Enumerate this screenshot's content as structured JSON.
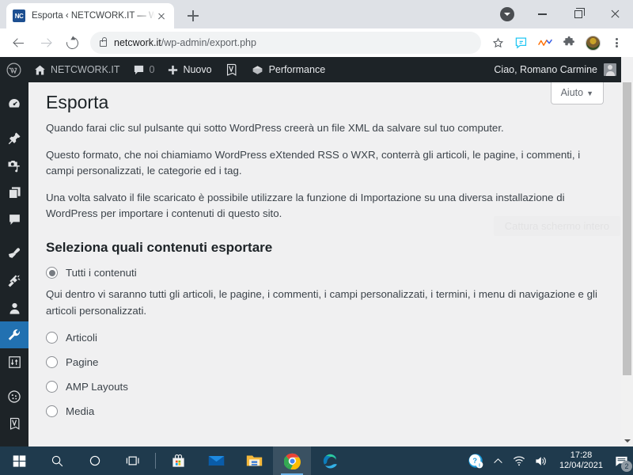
{
  "browser": {
    "tab": {
      "favicon_text": "NC",
      "title": "Esporta ‹ NETCWORK.IT — WordP",
      "close_icon": "close-icon"
    },
    "new_tab_label": "+",
    "tab_search_icon": "chevron-down-circle-icon",
    "window_controls": {
      "minimize": "minimize-icon",
      "maximize": "maximize-icon",
      "close": "close-icon"
    },
    "nav": {
      "back": "back-arrow-icon",
      "forward": "forward-arrow-icon",
      "reload": "reload-icon"
    },
    "omnibox": {
      "lock_icon": "lock-icon",
      "domain": "netcwork.it",
      "path": "/wp-admin/export.php",
      "full_url": "netcwork.it/wp-admin/export.php"
    },
    "toolbar_icons": [
      "bookmark-star-icon",
      "evernote-clipper-icon",
      "analytics-icon",
      "extensions-puzzle-icon",
      "profile-avatar",
      "chrome-menu-kebab-icon"
    ]
  },
  "adminbar": {
    "wp_logo": "wordpress-logo-icon",
    "site_icon": "home-icon",
    "site_name": "NETCWORK.IT",
    "comments_icon": "comment-bubble-icon",
    "comments_count": "0",
    "new_icon": "plus-icon",
    "new_label": "Nuovo",
    "yoast_icon": "yoast-seo-icon",
    "performance_icon": "performance-icon",
    "performance_label": "Performance",
    "greeting": "Ciao, Romano Carmine",
    "avatar": "user-avatar"
  },
  "sidebar": {
    "items": [
      {
        "name": "dashboard",
        "icon": "dashboard-gauge-icon",
        "active": false
      },
      {
        "name": "posts",
        "icon": "pin-icon",
        "active": false
      },
      {
        "name": "media",
        "icon": "media-camera-music-icon",
        "active": false
      },
      {
        "name": "pages",
        "icon": "pages-icon",
        "active": false
      },
      {
        "name": "comments",
        "icon": "comment-bubble-icon",
        "active": false
      },
      {
        "name": "appearance",
        "icon": "paintbrush-icon",
        "active": false
      },
      {
        "name": "plugins",
        "icon": "plug-icon",
        "active": false
      },
      {
        "name": "users",
        "icon": "user-icon",
        "active": false
      },
      {
        "name": "tools",
        "icon": "wrench-icon",
        "active": true
      },
      {
        "name": "settings",
        "icon": "settings-sliders-icon",
        "active": false
      },
      {
        "name": "cookies",
        "icon": "cookie-icon",
        "active": false
      },
      {
        "name": "yoast-seo",
        "icon": "yoast-seo-icon",
        "active": false
      }
    ]
  },
  "page": {
    "help_button": "Aiuto",
    "help_caret": "▼",
    "title": "Esporta",
    "paragraphs": [
      "Quando farai clic sul pulsante qui sotto WordPress creerà un file XML da salvare sul tuo computer.",
      "Questo formato, che noi chiamiamo WordPress eXtended RSS o WXR, conterrà gli articoli, le pagine, i commenti, i campi personalizzati, le categorie ed i tag.",
      "Una volta salvato il file scaricato è possibile utilizzare la funzione di Importazione su una diversa installazione di WordPress per importare i contenuti di questo sito."
    ],
    "section_title": "Seleziona quali contenuti esportare",
    "options": [
      {
        "label": "Tutti i contenuti",
        "checked": true,
        "description": "Qui dentro vi saranno tutti gli articoli, le pagine, i commenti, i campi personalizzati, i termini, i menu di navigazione e gli articoli personalizzati."
      },
      {
        "label": "Articoli",
        "checked": false,
        "description": ""
      },
      {
        "label": "Pagine",
        "checked": false,
        "description": ""
      },
      {
        "label": "AMP Layouts",
        "checked": false,
        "description": ""
      },
      {
        "label": "Media",
        "checked": false,
        "description": ""
      }
    ],
    "ghost_tooltip": "Cattura schermo intero"
  },
  "taskbar": {
    "items": [
      {
        "name": "start",
        "icon": "windows-start-icon",
        "active": false
      },
      {
        "name": "search",
        "icon": "search-magnifier-icon",
        "active": false
      },
      {
        "name": "cortana",
        "icon": "cortana-circle-icon",
        "active": false
      },
      {
        "name": "task-view",
        "icon": "task-view-icon",
        "active": false
      },
      {
        "name": "microsoft-store",
        "icon": "microsoft-store-icon",
        "active": false
      },
      {
        "name": "mail",
        "icon": "mail-envelope-icon",
        "active": false
      },
      {
        "name": "file-explorer",
        "icon": "file-explorer-folder-icon",
        "active": false
      },
      {
        "name": "google-chrome",
        "icon": "chrome-icon",
        "active": true
      },
      {
        "name": "microsoft-edge",
        "icon": "edge-icon",
        "active": false
      }
    ],
    "tray": {
      "help_icon": "help-question-icon",
      "overflow_icon": "chevron-up-icon",
      "network_icon": "wifi-icon",
      "volume_icon": "speaker-icon",
      "time": "17:28",
      "date": "12/04/2021",
      "notification_icon": "notification-icon",
      "notification_count": "2"
    }
  },
  "colors": {
    "wp_admin_dark": "#1d2327",
    "wp_accent_blue": "#2271b1",
    "wp_bg": "#f0f0f1",
    "taskbar": "#1f3a4d",
    "chrome_tabstrip": "#dee1e6"
  }
}
